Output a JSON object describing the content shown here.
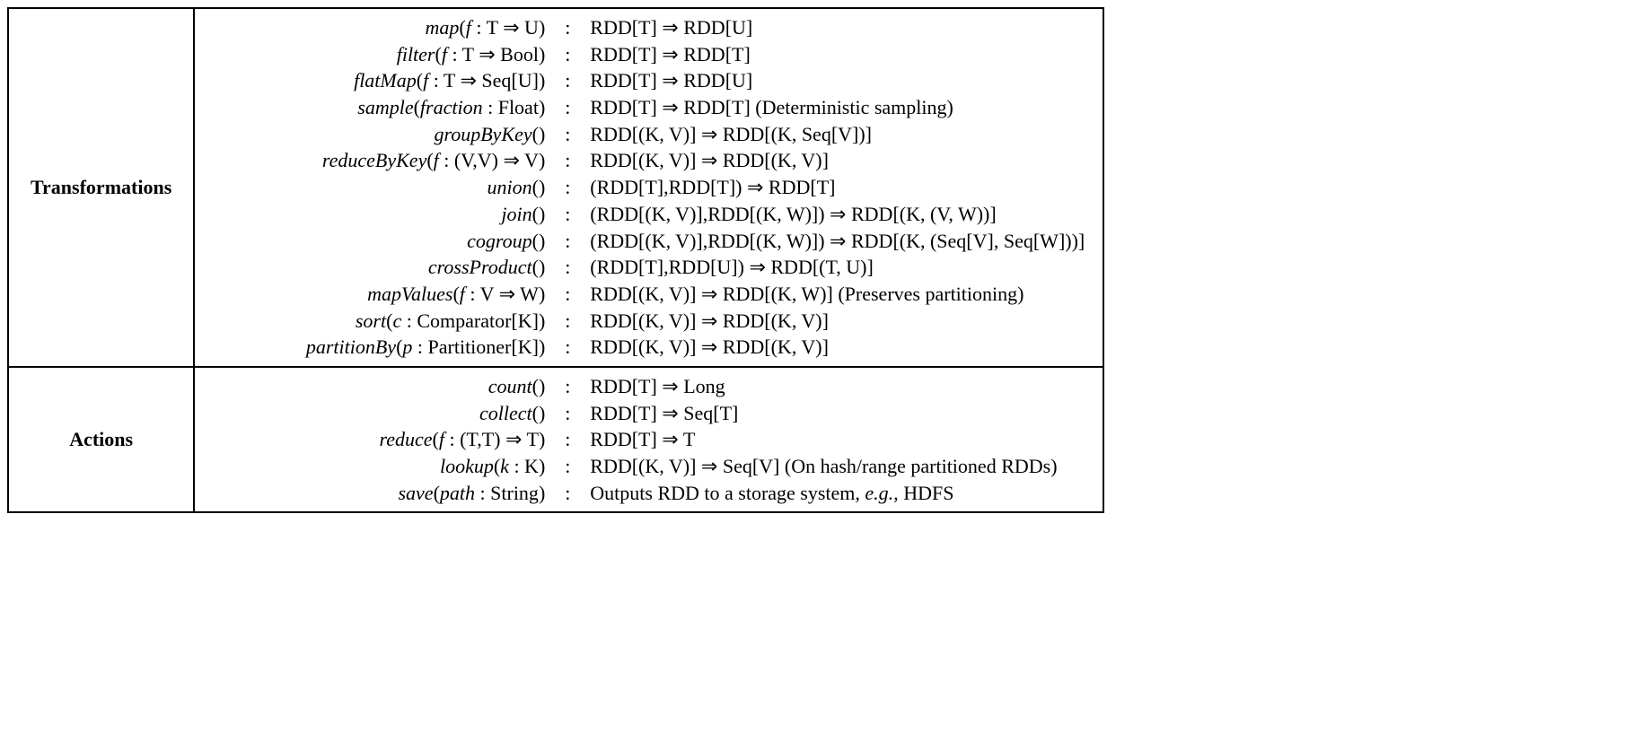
{
  "categories": {
    "transformations": "Transformations",
    "actions": "Actions"
  },
  "arrow": "⇒",
  "transformations": [
    {
      "fn": "map",
      "args_pre": "f",
      "args_type": ": T ⇒ U",
      "type": "RDD[T] ⇒ RDD[U]",
      "note": ""
    },
    {
      "fn": "filter",
      "args_pre": "f",
      "args_type": ": T ⇒ Bool",
      "type": "RDD[T] ⇒ RDD[T]",
      "note": ""
    },
    {
      "fn": "flatMap",
      "args_pre": "f",
      "args_type": ": T ⇒ Seq[U]",
      "type": "RDD[T] ⇒ RDD[U]",
      "note": ""
    },
    {
      "fn": "sample",
      "args_pre": "fraction",
      "args_type": ": Float",
      "type": "RDD[T] ⇒ RDD[T]",
      "note": "  (Deterministic sampling)"
    },
    {
      "fn": "groupByKey",
      "args_pre": "",
      "args_type": "",
      "type": "RDD[(K, V)] ⇒ RDD[(K, Seq[V])]",
      "note": ""
    },
    {
      "fn": "reduceByKey",
      "args_pre": "f",
      "args_type": ": (V,V) ⇒ V",
      "type": "RDD[(K, V)] ⇒ RDD[(K, V)]",
      "note": ""
    },
    {
      "fn": "union",
      "args_pre": "",
      "args_type": "",
      "type": "(RDD[T],RDD[T]) ⇒ RDD[T]",
      "note": ""
    },
    {
      "fn": "join",
      "args_pre": "",
      "args_type": "",
      "type": "(RDD[(K, V)],RDD[(K, W)]) ⇒ RDD[(K, (V, W))]",
      "note": ""
    },
    {
      "fn": "cogroup",
      "args_pre": "",
      "args_type": "",
      "type": "(RDD[(K, V)],RDD[(K, W)]) ⇒ RDD[(K, (Seq[V], Seq[W]))]",
      "note": ""
    },
    {
      "fn": "crossProduct",
      "args_pre": "",
      "args_type": "",
      "type": "(RDD[T],RDD[U]) ⇒ RDD[(T, U)]",
      "note": ""
    },
    {
      "fn": "mapValues",
      "args_pre": "f",
      "args_type": ": V ⇒ W",
      "type": "RDD[(K, V)] ⇒ RDD[(K, W)]",
      "note": "  (Preserves partitioning)"
    },
    {
      "fn": "sort",
      "args_pre": "c",
      "args_type": ": Comparator[K]",
      "type": "RDD[(K, V)] ⇒ RDD[(K, V)]",
      "note": ""
    },
    {
      "fn": "partitionBy",
      "args_pre": "p",
      "args_type": ": Partitioner[K]",
      "type": "RDD[(K, V)] ⇒ RDD[(K, V)]",
      "note": ""
    }
  ],
  "actions": [
    {
      "fn": "count",
      "args_pre": "",
      "args_type": "",
      "type": "RDD[T] ⇒ Long",
      "note": ""
    },
    {
      "fn": "collect",
      "args_pre": "",
      "args_type": "",
      "type": "RDD[T] ⇒ Seq[T]",
      "note": ""
    },
    {
      "fn": "reduce",
      "args_pre": "f",
      "args_type": ": (T,T) ⇒ T",
      "type": "RDD[T] ⇒ T",
      "note": ""
    },
    {
      "fn": "lookup",
      "args_pre": "k",
      "args_type": ": K",
      "type": "RDD[(K, V)] ⇒ Seq[V]",
      "note": "  (On hash/range partitioned RDDs)"
    },
    {
      "fn": "save",
      "args_pre": "path",
      "args_type": ": String",
      "type_pre": "Outputs RDD to a storage system, ",
      "type_eg": "e.g.,",
      "type_post": " HDFS"
    }
  ]
}
